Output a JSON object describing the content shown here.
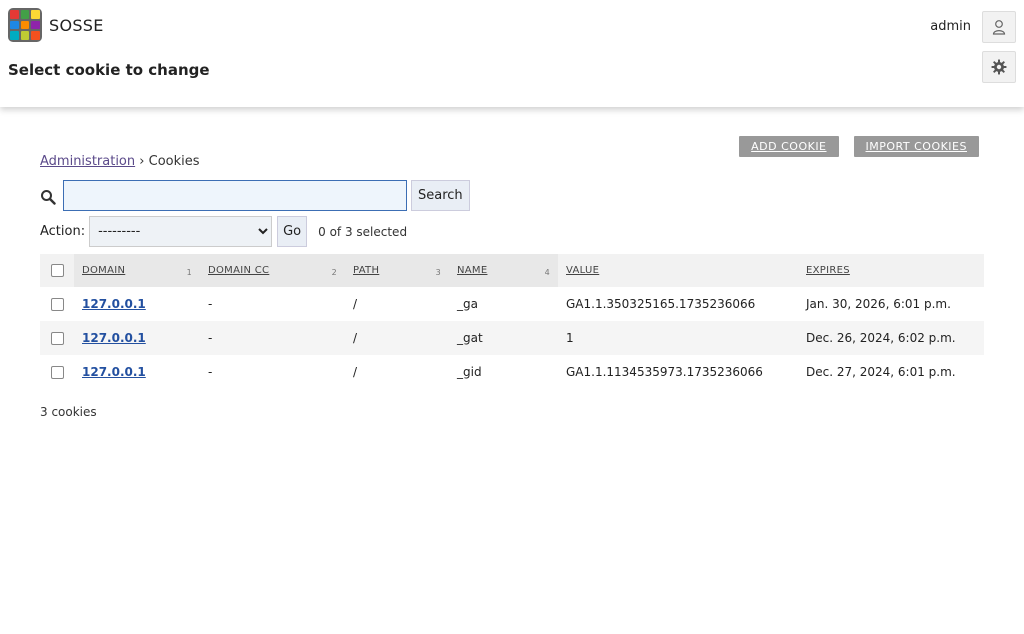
{
  "header": {
    "brand": "SOSSE",
    "page_title": "Select cookie to change",
    "username": "admin",
    "logo_colors": [
      "#e53935",
      "#43a047",
      "#fdd835",
      "#1e88e5",
      "#fb8c00",
      "#8e24aa",
      "#00acc1",
      "#c0ca33",
      "#f4511e"
    ]
  },
  "tools": {
    "add_label": "ADD COOKIE",
    "import_label": "IMPORT COOKIES"
  },
  "breadcrumb": {
    "root": "Administration",
    "separator": "›",
    "current": "Cookies"
  },
  "search": {
    "value": "",
    "placeholder": "",
    "button": "Search"
  },
  "actions": {
    "label": "Action:",
    "selected_option": "---------",
    "go": "Go",
    "selected_count": "0 of 3 selected"
  },
  "table": {
    "columns": [
      {
        "label": "Domain",
        "sort": "1"
      },
      {
        "label": "Domain cc",
        "sort": "2"
      },
      {
        "label": "Path",
        "sort": "3"
      },
      {
        "label": "Name",
        "sort": "4"
      },
      {
        "label": "Value",
        "sort": ""
      },
      {
        "label": "Expires",
        "sort": ""
      }
    ],
    "rows": [
      {
        "domain": "127.0.0.1",
        "domain_cc": "-",
        "path": "/",
        "name": "_ga",
        "value": "GA1.1.350325165.1735236066",
        "expires": "Jan. 30, 2026, 6:01 p.m."
      },
      {
        "domain": "127.0.0.1",
        "domain_cc": "-",
        "path": "/",
        "name": "_gat",
        "value": "1",
        "expires": "Dec. 26, 2024, 6:02 p.m."
      },
      {
        "domain": "127.0.0.1",
        "domain_cc": "-",
        "path": "/",
        "name": "_gid",
        "value": "GA1.1.1134535973.1735236066",
        "expires": "Dec. 27, 2024, 6:01 p.m."
      }
    ]
  },
  "paginator": "3 cookies",
  "icons": {
    "user": "user-icon",
    "settings": "gear-icon",
    "search": "search-icon"
  }
}
